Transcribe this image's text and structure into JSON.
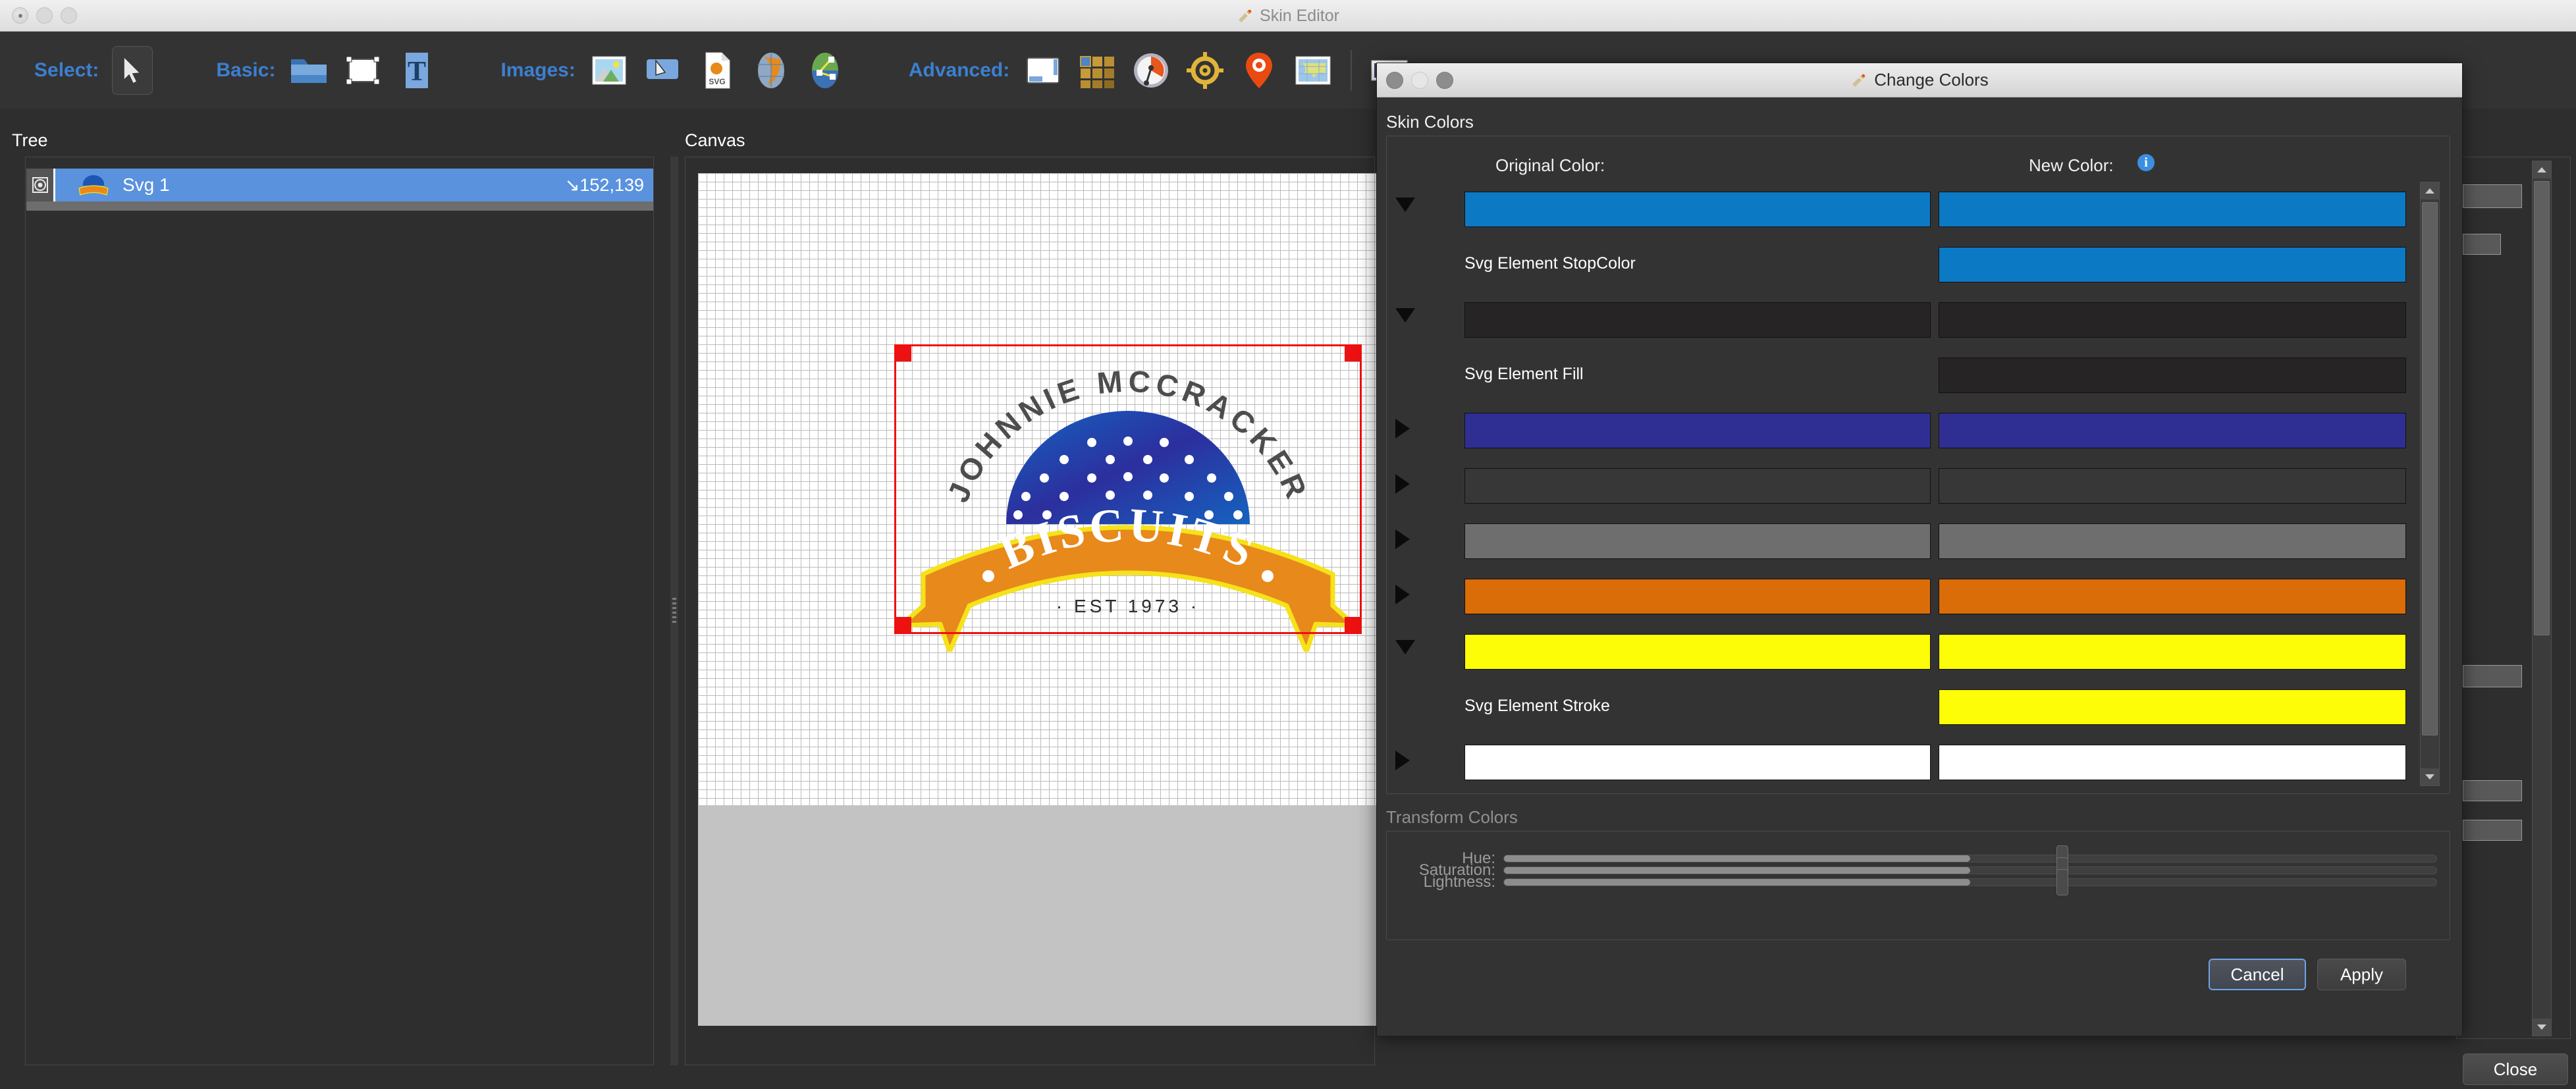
{
  "window": {
    "title": "Skin Editor",
    "icon": "skin-editor-icon"
  },
  "toolbar": {
    "groups": [
      {
        "label": "Select:",
        "icons": [
          {
            "name": "arrow-cursor-icon",
            "selected": true
          }
        ]
      },
      {
        "label": "Basic:",
        "icons": [
          {
            "name": "folder-icon"
          },
          {
            "name": "rectangle-icon"
          },
          {
            "name": "text-icon"
          }
        ]
      },
      {
        "label": "Images:",
        "icons": [
          {
            "name": "image-icon"
          },
          {
            "name": "image-button-icon"
          },
          {
            "name": "svg-file-icon"
          },
          {
            "name": "globe-map-icon"
          },
          {
            "name": "network-map-icon"
          }
        ]
      },
      {
        "label": "Advanced:",
        "icons": [
          {
            "name": "layout-panel-icon"
          },
          {
            "name": "grid-tiles-icon"
          },
          {
            "name": "gauge-icon"
          },
          {
            "name": "crosshair-target-icon"
          },
          {
            "name": "map-pin-icon"
          },
          {
            "name": "world-map-icon"
          },
          {
            "name": "panorama-icon"
          },
          {
            "name": "graph-icon"
          },
          {
            "name": "slider-icon"
          },
          {
            "name": "document-icon"
          },
          {
            "name": "book-icon"
          },
          {
            "name": "tools-icon"
          }
        ]
      }
    ]
  },
  "tree": {
    "title": "Tree",
    "items": [
      {
        "label": "Svg 1",
        "coordinates": "152,139",
        "coord_icon": "arrow-down-right-icon",
        "visibility_icon": "eye-icon",
        "thumbnail_icon": "biscuits-logo-icon",
        "selected": true
      }
    ]
  },
  "canvas": {
    "title": "Canvas",
    "artwork": {
      "arc_text": "JOHNNIE MCCRACKER",
      "banner_text": "BISCUITS",
      "established_text": "· EST 1973 ·",
      "dome_color": "#1e56b4",
      "dome_color_dark": "#2c2f9e",
      "banner_color": "#e88712",
      "banner_stroke": "#f5e21a",
      "arc_text_color": "#4d4d4d"
    },
    "selection_color": "#ee1111"
  },
  "dialog": {
    "title": "Change Colors",
    "title_icon": "skin-editor-icon",
    "skin_colors": {
      "heading": "Skin Colors",
      "original_header": "Original Color:",
      "new_header": "New Color:",
      "info_icon": "info-icon",
      "info_glyph": "i",
      "rows": [
        {
          "expander": "down",
          "original": "#0c79c4",
          "new": "#0c79c4"
        },
        {
          "label": "Svg Element StopColor",
          "original": null,
          "new": "#0c79c4"
        },
        {
          "expander": "down",
          "original": "#272425",
          "new": "#272425"
        },
        {
          "label": "Svg Element Fill",
          "original": null,
          "new": "#272425"
        },
        {
          "expander": "right",
          "original": "#2f2f93",
          "new": "#2f2f93"
        },
        {
          "expander": "right",
          "original": "#373737",
          "new": "#373737"
        },
        {
          "expander": "right",
          "original": "#6e6e6e",
          "new": "#6e6e6e"
        },
        {
          "expander": "right",
          "original": "#da6d07",
          "new": "#da6d07"
        },
        {
          "expander": "down",
          "original": "#fdfd07",
          "new": "#fdfd07"
        },
        {
          "label": "Svg Element Stroke",
          "original": null,
          "new": "#fdfd07"
        },
        {
          "expander": "right",
          "original": "#ffffff",
          "new": "#ffffff"
        }
      ]
    },
    "transform_colors": {
      "heading": "Transform Colors",
      "sliders": [
        {
          "label": "Hue:",
          "value": 50
        },
        {
          "label": "Saturation:",
          "value": 50
        },
        {
          "label": "Lightness:",
          "value": 50
        }
      ]
    },
    "buttons": {
      "cancel": "Cancel",
      "apply": "Apply"
    }
  },
  "footer": {
    "close": "Close"
  }
}
